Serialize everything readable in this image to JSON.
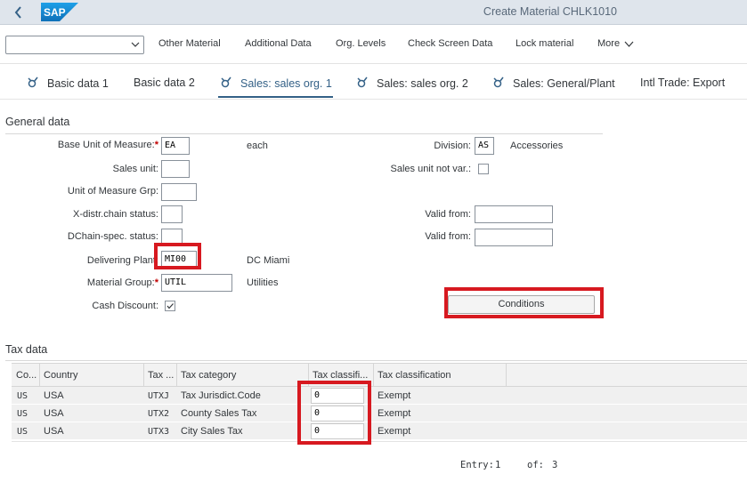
{
  "header": {
    "title": "Create Material CHLK1010",
    "logo_text": "SAP"
  },
  "toolbar": {
    "select_value": "",
    "buttons": [
      "Other Material",
      "Additional Data",
      "Org. Levels",
      "Check Screen Data",
      "Lock material"
    ],
    "more_label": "More"
  },
  "tabs": [
    {
      "label": "Basic data 1",
      "icon": "glasses-icon"
    },
    {
      "label": "Basic data 2",
      "icon": ""
    },
    {
      "label": "Sales: sales org. 1",
      "icon": "glasses-icon",
      "active": true
    },
    {
      "label": "Sales: sales org. 2",
      "icon": "glasses-icon"
    },
    {
      "label": "Sales: General/Plant",
      "icon": "glasses-icon"
    },
    {
      "label": "Intl Trade: Export",
      "icon": ""
    }
  ],
  "general": {
    "title": "General data",
    "base_uom": {
      "label": "Base Unit of Measure:",
      "required": "*",
      "value": "EA",
      "desc": "each"
    },
    "sales_unit": {
      "label": "Sales unit:",
      "value": ""
    },
    "uom_grp": {
      "label": "Unit of Measure Grp:",
      "value": ""
    },
    "xdistr": {
      "label": "X-distr.chain status:",
      "value": ""
    },
    "dchain": {
      "label": "DChain-spec. status:",
      "value": ""
    },
    "delivering_plant": {
      "label": "Delivering Plant:",
      "value": "MI00",
      "desc": "DC Miami"
    },
    "material_group": {
      "label": "Material Group:",
      "required": "*",
      "value": "UTIL",
      "desc": "Utilities"
    },
    "cash_discount": {
      "label": "Cash Discount:",
      "checked": true
    },
    "division": {
      "label": "Division:",
      "value": "AS",
      "desc": "Accessories"
    },
    "sales_unit_not_var": {
      "label": "Sales unit not var.:",
      "checked": false
    },
    "valid_from_1": {
      "label": "Valid from:",
      "value": ""
    },
    "valid_from_2": {
      "label": "Valid from:",
      "value": ""
    },
    "conditions_label": "Conditions"
  },
  "tax": {
    "title": "Tax data",
    "columns": [
      "Co...",
      "Country",
      "Tax ...",
      "Tax category",
      "Tax classifi...",
      "Tax classification"
    ],
    "rows": [
      {
        "co": "US",
        "country": "USA",
        "tax": "UTXJ",
        "category": "Tax Jurisdict.Code",
        "classif": "0",
        "classification": "Exempt"
      },
      {
        "co": "US",
        "country": "USA",
        "tax": "UTX2",
        "category": "County Sales Tax",
        "classif": "0",
        "classification": "Exempt"
      },
      {
        "co": "US",
        "country": "USA",
        "tax": "UTX3",
        "category": "City Sales Tax",
        "classif": "0",
        "classification": "Exempt"
      }
    ],
    "entry_label": "Entry:",
    "entry_value": "1",
    "of_label": "of:",
    "of_value": "3"
  },
  "colors": {
    "highlight": "#d71920",
    "shell": "#dfe5ec",
    "sap_blue": "#1a8ad6",
    "active_tab": "#346187"
  }
}
